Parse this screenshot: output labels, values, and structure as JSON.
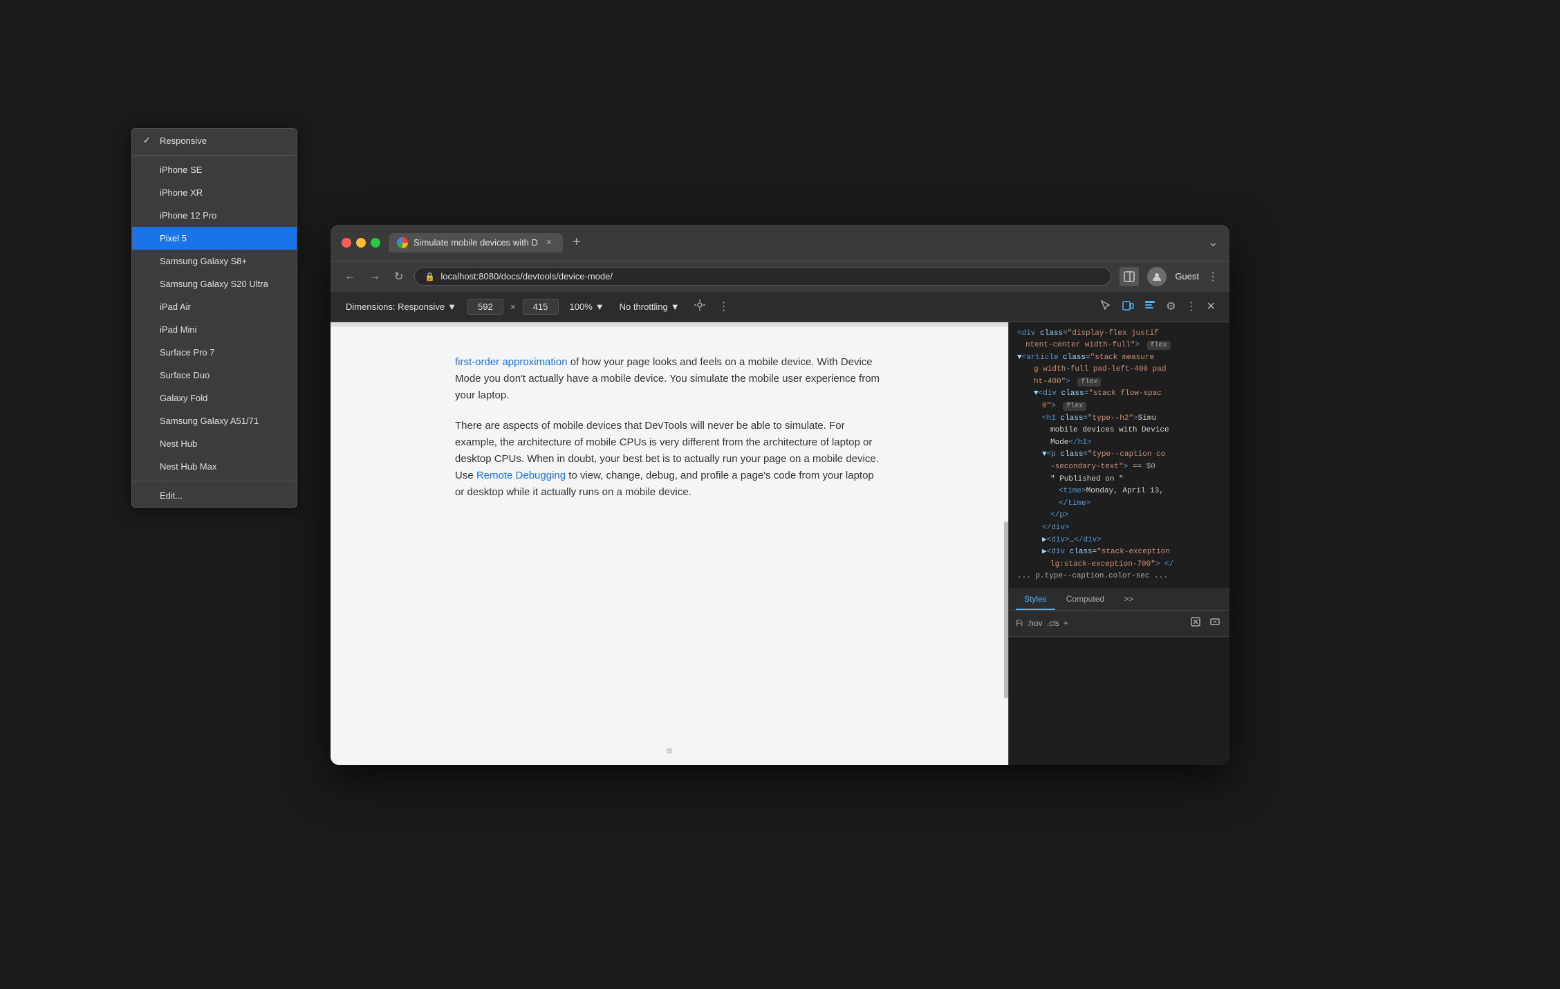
{
  "window": {
    "title": "Simulate mobile devices with D",
    "url": "localhost:8080/docs/devtools/device-mode/",
    "guest_label": "Guest"
  },
  "toolbar": {
    "dimensions_label": "Dimensions: Responsive",
    "width_value": "592",
    "height_value": "415",
    "zoom_label": "100%",
    "throttle_label": "No throttling"
  },
  "dropdown": {
    "items": [
      {
        "id": "responsive",
        "label": "Responsive",
        "checked": true,
        "active": false
      },
      {
        "id": "iphone-se",
        "label": "iPhone SE",
        "checked": false,
        "active": false
      },
      {
        "id": "iphone-xr",
        "label": "iPhone XR",
        "checked": false,
        "active": false
      },
      {
        "id": "iphone-12-pro",
        "label": "iPhone 12 Pro",
        "checked": false,
        "active": false
      },
      {
        "id": "pixel-5",
        "label": "Pixel 5",
        "checked": false,
        "active": true
      },
      {
        "id": "samsung-s8",
        "label": "Samsung Galaxy S8+",
        "checked": false,
        "active": false
      },
      {
        "id": "samsung-s20",
        "label": "Samsung Galaxy S20 Ultra",
        "checked": false,
        "active": false
      },
      {
        "id": "ipad-air",
        "label": "iPad Air",
        "checked": false,
        "active": false
      },
      {
        "id": "ipad-mini",
        "label": "iPad Mini",
        "checked": false,
        "active": false
      },
      {
        "id": "surface-pro",
        "label": "Surface Pro 7",
        "checked": false,
        "active": false
      },
      {
        "id": "surface-duo",
        "label": "Surface Duo",
        "checked": false,
        "active": false
      },
      {
        "id": "galaxy-fold",
        "label": "Galaxy Fold",
        "checked": false,
        "active": false
      },
      {
        "id": "samsung-a51",
        "label": "Samsung Galaxy A51/71",
        "checked": false,
        "active": false
      },
      {
        "id": "nest-hub",
        "label": "Nest Hub",
        "checked": false,
        "active": false
      },
      {
        "id": "nest-hub-max",
        "label": "Nest Hub Max",
        "checked": false,
        "active": false
      },
      {
        "id": "edit",
        "label": "Edit...",
        "checked": false,
        "active": false,
        "divider_before": true
      }
    ]
  },
  "page": {
    "link1": "first-order approximation",
    "para1": " of how your page looks and feels on a mobile device. With Device Mode you don't actually have a mobile device. You simulate the mobile user experience from your laptop.",
    "para2_pre": "There are aspects of mobile devices that DevTools will never be able to simulate. For example, the architecture of mobile CPUs is very different from the architecture of laptop or desktop CPUs. When in doubt, your best bet is to actually run your page on a mobile device. Use ",
    "link2": "Remote Debugging",
    "para2_post": " to view, change, debug, and profile a page's code from your laptop or desktop while it actually runs on a mobile device."
  },
  "devtools": {
    "tabs": {
      "styles_label": "Styles",
      "computed_label": "Computed",
      "more_label": ">>"
    },
    "filter": {
      "fi_label": "Fi",
      "hov_label": ":hov",
      "cls_label": ".cls",
      "plus_label": "+"
    },
    "code": [
      "<div class=\"display-flex justif",
      "ntent-center width-full\"> flex",
      "<article class=\"stack measure",
      "g width-full pad-left-400 pad",
      "ht-400\"> flex",
      "<div class=\"stack flow-spac",
      "0\"> flex",
      "<h1 class=\"type--h2\">Simu",
      "mobile devices with Device",
      "Mode</h1>",
      "<p class=\"type--caption co",
      "-secondary-text\"> == $0",
      "\" Published on \"",
      "<time>Monday, April 13,",
      "</time>",
      "</p>",
      "</div>",
      "<div>…</div>",
      "<div class=\"stack-exception",
      "lg:stack-exception-700\"> </",
      "... p.type--caption.color-sec ..."
    ]
  }
}
